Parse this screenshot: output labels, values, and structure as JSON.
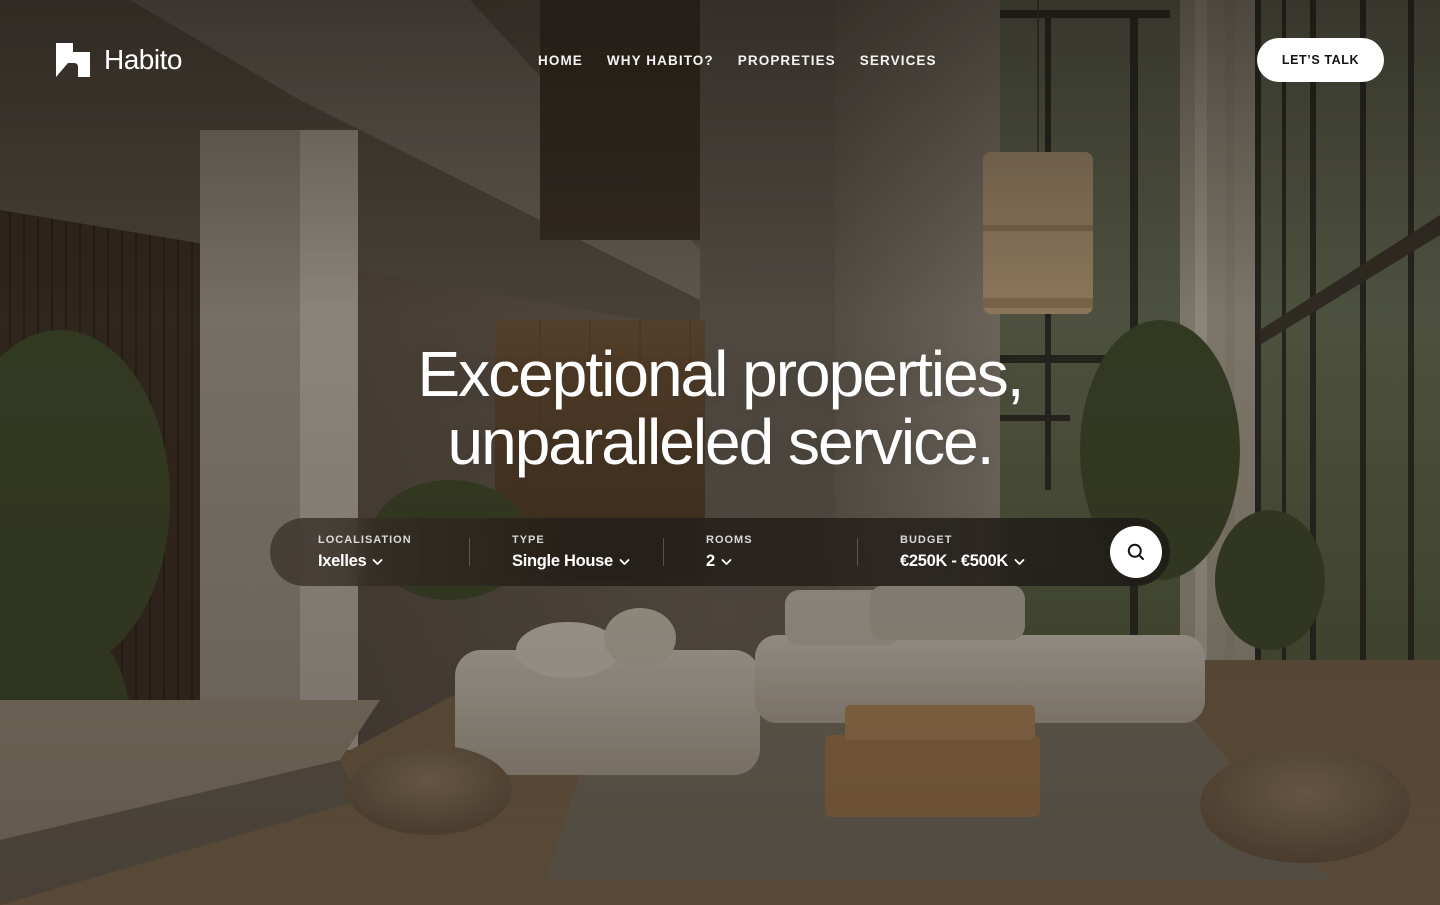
{
  "brand": {
    "name": "Habito",
    "logo_icon": "habito-logo-mark"
  },
  "nav": {
    "items": [
      {
        "label": "HOME"
      },
      {
        "label": "WHY HABITO?"
      },
      {
        "label": "PROPRETIES"
      },
      {
        "label": "SERVICES"
      }
    ],
    "cta_label": "LET’S TALK"
  },
  "hero": {
    "title_line1": "Exceptional properties,",
    "title_line2": "unparalleled service.",
    "background": "modern-living-room-interior-photo"
  },
  "search": {
    "fields": [
      {
        "label": "LOCALISATION",
        "value": "Ixelles",
        "icon": "chevron-down-icon"
      },
      {
        "label": "TYPE",
        "value": "Single House",
        "icon": "chevron-down-icon"
      },
      {
        "label": "ROOMS",
        "value": "2",
        "icon": "chevron-down-icon"
      },
      {
        "label": "BUDGET",
        "value": "€250K - €500K",
        "icon": "chevron-down-icon"
      }
    ],
    "button_icon": "search-icon"
  },
  "colors": {
    "text": "#ffffff",
    "cta_bg": "#ffffff",
    "cta_text": "#141414",
    "search_bar_bg": "#2a241e"
  }
}
